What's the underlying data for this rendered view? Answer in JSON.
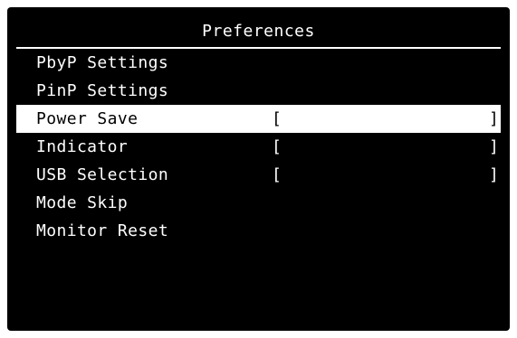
{
  "window": {
    "title": "Preferences"
  },
  "menu": {
    "items": [
      {
        "label": "PbyP Settings"
      },
      {
        "label": "PinP Settings"
      },
      {
        "label": "Power Save",
        "bracket_open": "[",
        "value": "",
        "bracket_close": "]",
        "selected": true
      },
      {
        "label": "Indicator",
        "bracket_open": "[",
        "value": "",
        "bracket_close": "]"
      },
      {
        "label": "USB Selection",
        "bracket_open": "[",
        "value": "",
        "bracket_close": "]"
      },
      {
        "label": "Mode Skip"
      },
      {
        "label": "Monitor Reset"
      }
    ]
  },
  "colors": {
    "background": "#000000",
    "foreground": "#ffffff",
    "highlight": "#ffffff"
  }
}
